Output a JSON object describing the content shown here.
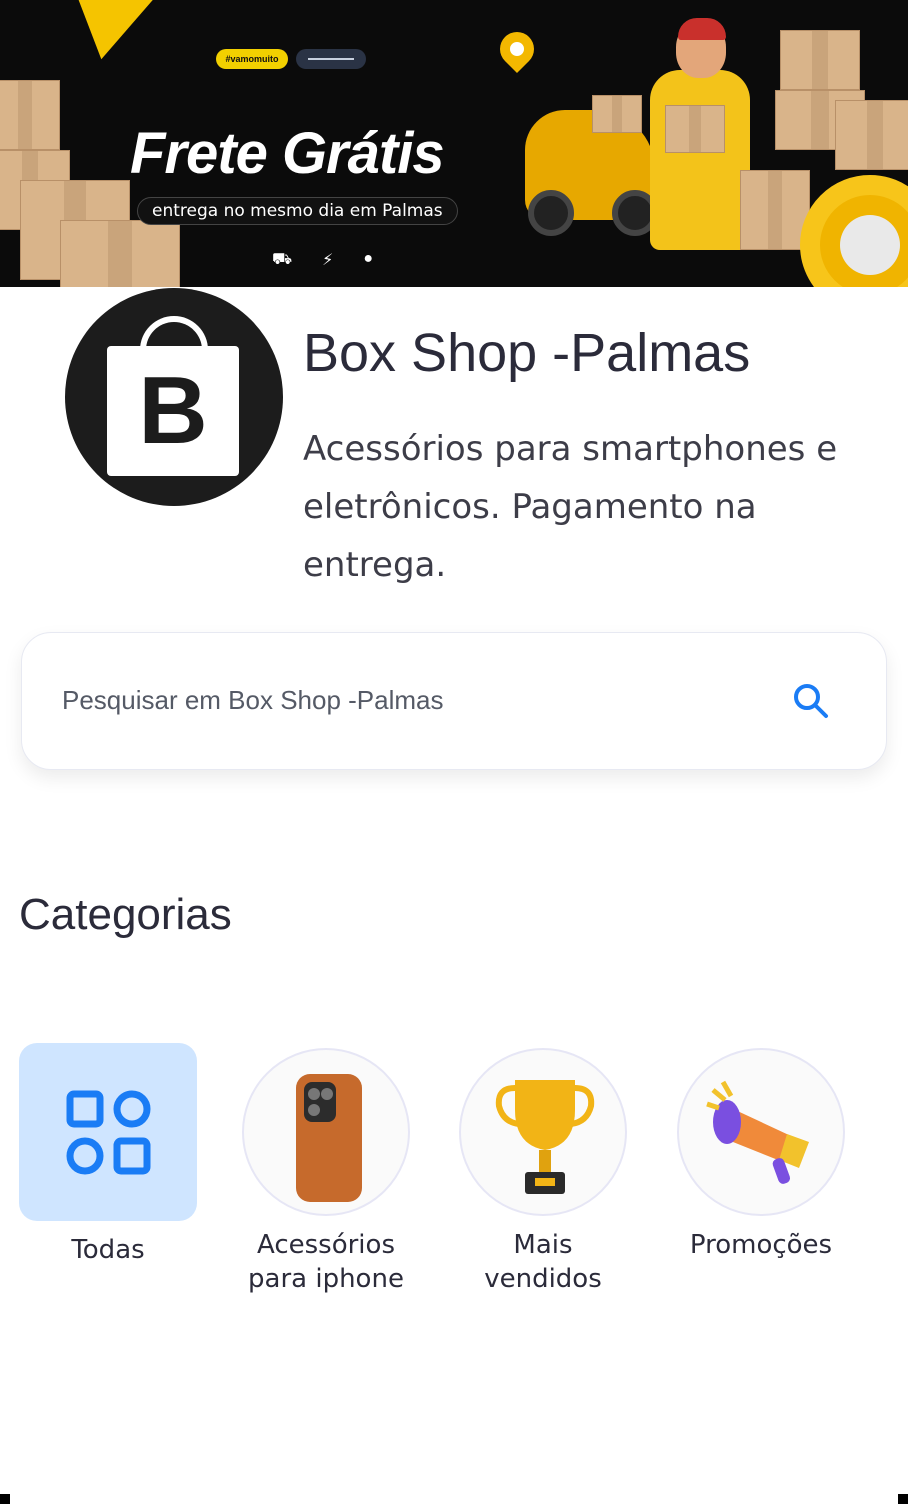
{
  "banner": {
    "chip_text": "#vamomuito",
    "title": "Frete Grátis",
    "subtitle": "entrega no mesmo dia em Palmas",
    "icons": [
      "truck-icon",
      "lightning-icon",
      "shield-icon"
    ]
  },
  "store": {
    "logo_letter": "B",
    "name": "Box Shop -Palmas",
    "description": "Acessórios para smartphones e eletrônicos. Pagamento  na entrega."
  },
  "search": {
    "placeholder": "Pesquisar em Box Shop -Palmas",
    "icon": "search-icon"
  },
  "categories": {
    "title": "Categorias",
    "items": [
      {
        "label": "Todas",
        "icon": "grid-icon",
        "selected": true
      },
      {
        "label": "Acessórios para iphone",
        "icon": "iphone-case-image"
      },
      {
        "label": "Mais vendidos",
        "icon": "trophy-image"
      },
      {
        "label": "Promoções",
        "icon": "megaphone-image"
      }
    ]
  },
  "colors": {
    "accent": "#1a7cf5",
    "selected_bg": "#cfe5ff",
    "banner_bg": "#0b0b0b",
    "banner_yellow": "#f3c31a"
  }
}
